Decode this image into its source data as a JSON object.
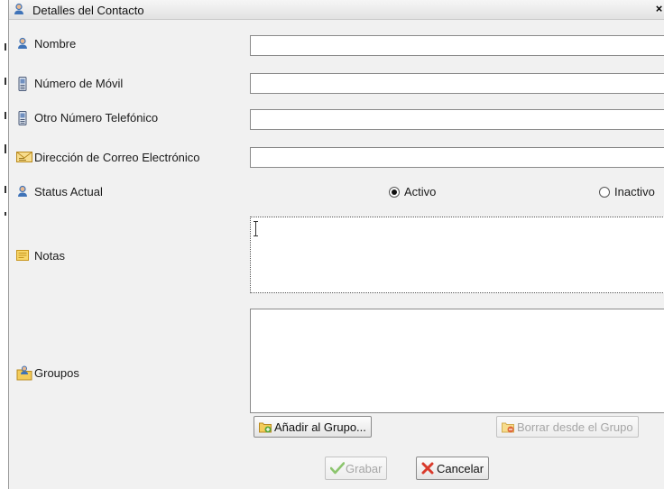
{
  "window": {
    "title": "Detalles del Contacto",
    "close_glyph": "×"
  },
  "fields": {
    "nombre": {
      "label": "Nombre",
      "value": ""
    },
    "movil": {
      "label": "Número de Móvil",
      "value": ""
    },
    "otro_telefono": {
      "label": "Otro Número Telefónico",
      "value": ""
    },
    "correo": {
      "label": "Dirección de Correo Electrónico",
      "value": ""
    }
  },
  "status": {
    "label": "Status Actual",
    "options": [
      {
        "label": "Activo",
        "checked": true
      },
      {
        "label": "Inactivo",
        "checked": false
      }
    ]
  },
  "notas": {
    "label": "Notas",
    "value": ""
  },
  "grupos": {
    "label": "Groupos",
    "add_button": "Añadir al Grupo...",
    "remove_button": "Borrar desde el Grupo"
  },
  "footer": {
    "save": "Grabar",
    "cancel": "Cancelar"
  },
  "colors": {
    "person_icon": "#3f73b8",
    "note_icon": "#f0b62b",
    "save_check": "#5aa83b",
    "cancel_x": "#d93a2b"
  },
  "icons": {
    "title": "person-icon",
    "nombre": "person-icon",
    "movil": "phone-icon",
    "otro": "phone-icon",
    "correo": "envelope-icon",
    "status": "person-icon",
    "notas": "note-icon",
    "grupos": "folder-person-icon",
    "save": "checkmark-icon",
    "cancel": "x-icon"
  }
}
